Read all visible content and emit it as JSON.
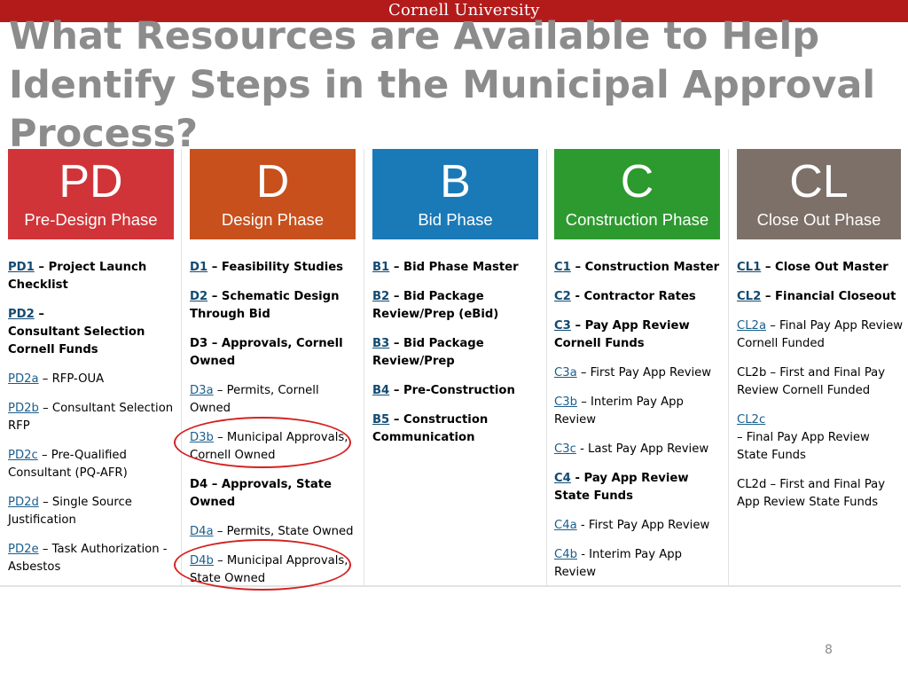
{
  "header": {
    "brand": "Cornell University"
  },
  "title": {
    "lines": [
      "What Resources are Available to Help",
      "Identify Steps in the Municipal Approval",
      "Process?"
    ]
  },
  "columns": [
    {
      "code": "PD",
      "phase": "Pre-Design Phase",
      "color": "#d13438",
      "items": [
        {
          "link": "PD1",
          "lines": [
            "– Project Launch",
            "Checklist"
          ],
          "bold": true
        },
        {
          "link": "PD2",
          "lines": [
            "–",
            "Consultant Selection",
            "Cornell Funds"
          ],
          "bold": true
        },
        {
          "link": "PD2a",
          "lines": [
            "– RFP-OUA"
          ],
          "bold": false
        },
        {
          "link": "PD2b",
          "lines": [
            "– Consultant Selection",
            "RFP"
          ],
          "bold": false
        },
        {
          "link": "PD2c",
          "lines": [
            "– Pre-Qualified",
            "Consultant (PQ-AFR)"
          ],
          "bold": false
        },
        {
          "link": "PD2d",
          "lines": [
            "– Single Source",
            "Justification"
          ],
          "bold": false
        },
        {
          "link": "PD2e",
          "lines": [
            "– Task Authorization -",
            "Asbestos"
          ],
          "bold": false
        }
      ]
    },
    {
      "code": "D",
      "phase": "Design Phase",
      "color": "#c8501c",
      "items": [
        {
          "link": "D1",
          "lines": [
            "– Feasibility Studies"
          ],
          "bold": true
        },
        {
          "link": "D2",
          "lines": [
            "– Schematic Design",
            "Through Bid"
          ],
          "bold": true
        },
        {
          "link": "",
          "lines": [
            "D3 – Approvals, Cornell",
            "Owned"
          ],
          "bold": true
        },
        {
          "link": "D3a",
          "lines": [
            "– Permits, Cornell",
            "Owned"
          ],
          "bold": false
        },
        {
          "link": "D3b",
          "lines": [
            "– Municipal Approvals,",
            "Cornell Owned"
          ],
          "bold": false
        },
        {
          "link": "",
          "lines": [
            "D4 – Approvals, State",
            "Owned"
          ],
          "bold": true
        },
        {
          "link": "D4a",
          "lines": [
            "– Permits, State Owned"
          ],
          "bold": false
        },
        {
          "link": "D4b",
          "lines": [
            "– Municipal Approvals,",
            "State Owned"
          ],
          "bold": false
        }
      ]
    },
    {
      "code": "B",
      "phase": "Bid Phase",
      "color": "#1a7ab8",
      "items": [
        {
          "link": "B1",
          "lines": [
            "– Bid Phase Master"
          ],
          "bold": true
        },
        {
          "link": "B2",
          "lines": [
            "– Bid Package",
            "Review/Prep (eBid)"
          ],
          "bold": true
        },
        {
          "link": "B3",
          "lines": [
            "– Bid Package",
            "Review/Prep"
          ],
          "bold": true
        },
        {
          "link": "B4",
          "lines": [
            "– Pre-Construction"
          ],
          "bold": true
        },
        {
          "link": "B5",
          "lines": [
            "– Construction",
            "Communication"
          ],
          "bold": true
        }
      ]
    },
    {
      "code": "C",
      "phase": "Construction Phase",
      "color": "#2c9a2e",
      "items": [
        {
          "link": "C1",
          "lines": [
            "– Construction Master"
          ],
          "bold": true
        },
        {
          "link": "C2",
          "lines": [
            "- Contractor Rates"
          ],
          "bold": true
        },
        {
          "link": "C3",
          "lines": [
            "– Pay App Review",
            "Cornell Funds"
          ],
          "bold": true
        },
        {
          "link": "C3a",
          "lines": [
            "– First Pay App Review"
          ],
          "bold": false
        },
        {
          "link": "C3b",
          "lines": [
            "– Interim Pay App",
            "Review"
          ],
          "bold": false
        },
        {
          "link": "C3c",
          "lines": [
            "- Last Pay App Review"
          ],
          "bold": false
        },
        {
          "link": "C4",
          "lines": [
            "- Pay App Review",
            "State Funds"
          ],
          "bold": true
        },
        {
          "link": "C4a",
          "lines": [
            "- First Pay App Review"
          ],
          "bold": false
        },
        {
          "link": "C4b",
          "lines": [
            "- Interim Pay App",
            "Review"
          ],
          "bold": false
        }
      ]
    },
    {
      "code": "CL",
      "phase": "Close Out Phase",
      "color": "#7c7068",
      "items": [
        {
          "link": "CL1",
          "lines": [
            "– Close Out Master"
          ],
          "bold": true
        },
        {
          "link": "CL2",
          "lines": [
            "– Financial Closeout"
          ],
          "bold": true
        },
        {
          "link": "CL2a",
          "lines": [
            "– Final Pay App Review",
            "Cornell Funded"
          ],
          "bold": false
        },
        {
          "link": "",
          "lines": [
            "CL2b – First and Final Pay",
            "Review Cornell Funded"
          ],
          "bold": false
        },
        {
          "link": "CL2c",
          "lines": [
            "",
            "– Final Pay App Review",
            "State Funds"
          ],
          "bold": false
        },
        {
          "link": "",
          "lines": [
            "CL2d – First and Final Pay",
            "App Review State Funds"
          ],
          "bold": false
        }
      ]
    }
  ],
  "page_number": "8"
}
